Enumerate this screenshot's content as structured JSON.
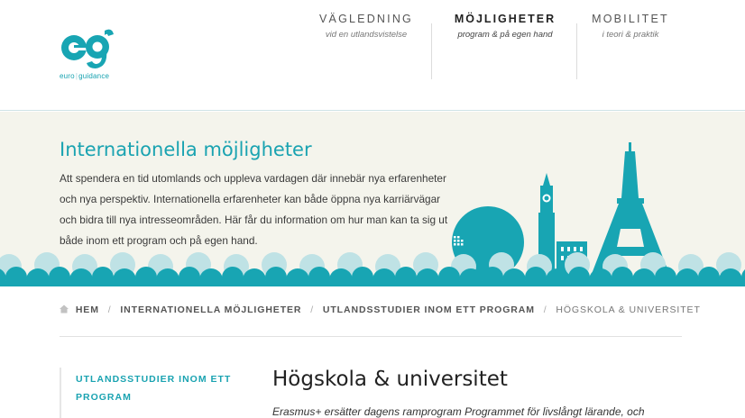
{
  "logo": {
    "mark": "eg",
    "left_text": "euro",
    "right_text": "guidance",
    "alt": "euroguidance-logo"
  },
  "nav": [
    {
      "title": "VÄGLEDNING",
      "sub": "vid en utlandsvistelse",
      "active": false
    },
    {
      "title": "MÖJLIGHETER",
      "sub": "program & på egen hand",
      "active": true
    },
    {
      "title": "MOBILITET",
      "sub": "i teori & praktik",
      "active": false
    }
  ],
  "hero": {
    "title": "Internationella möjligheter",
    "lines": [
      "Att spendera en tid utomlands och uppleva vardagen där innebär nya erfarenheter",
      "och nya perspektiv. Internationella erfarenheter kan både öppna nya karriärvägar",
      "och bidra till nya intresseområden. Här får du information om hur man kan ta sig ut",
      "både inom ett program och på egen hand."
    ]
  },
  "breadcrumb": {
    "home": "HEM",
    "items": [
      "INTERNATIONELLA MÖJLIGHETER",
      "UTLANDSSTUDIER INOM ETT PROGRAM"
    ],
    "current": "HÖGSKOLA & UNIVERSITET",
    "separator": "/"
  },
  "sidebar": {
    "link": "UTLANDSSTUDIER INOM ETT PROGRAM"
  },
  "main": {
    "title": "Högskola & universitet",
    "text": "Erasmus+ ersätter dagens ramprogram Programmet för livslångt lärande, och"
  },
  "colors": {
    "accent": "#1aa3b1",
    "cloud_dark": "#18a5b3",
    "cloud_light": "#bfe2e5",
    "hero_bg": "#f4f4ec"
  },
  "icons": {
    "home": "home-icon"
  }
}
